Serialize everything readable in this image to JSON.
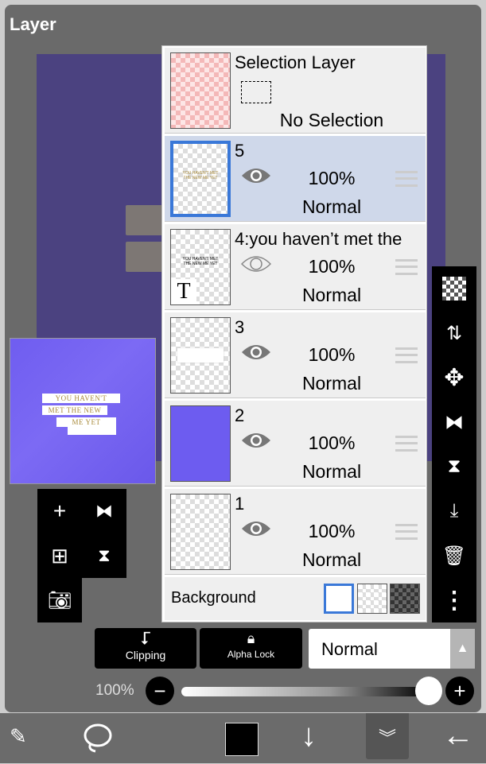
{
  "title": "Layer",
  "canvas_text": [
    "YOU HAVEN'T",
    "MET THE NEW",
    "ME YET"
  ],
  "selection_layer": {
    "name": "Selection Layer",
    "status": "No Selection"
  },
  "layers": [
    {
      "name": "5",
      "opacity": "100%",
      "mode": "Normal",
      "selected": true,
      "visible": true
    },
    {
      "name": "4:you haven’t met the",
      "opacity": "100%",
      "mode": "Normal",
      "selected": false,
      "visible": false,
      "type_icon": "T"
    },
    {
      "name": "3",
      "opacity": "100%",
      "mode": "Normal",
      "selected": false,
      "visible": true
    },
    {
      "name": "2",
      "opacity": "100%",
      "mode": "Normal",
      "selected": false,
      "visible": true
    },
    {
      "name": "1",
      "opacity": "100%",
      "mode": "Normal",
      "selected": false,
      "visible": true
    }
  ],
  "background": {
    "label": "Background"
  },
  "controls": {
    "clipping": "Clipping",
    "alpha_lock": "Alpha Lock",
    "blend_mode": "Normal",
    "opacity": "100%",
    "opacity_value": 100
  },
  "colors": {
    "accent": "#3a78d8",
    "canvas": "#4b4280",
    "layer2": "#6d5cf0",
    "primary_color": "#000000"
  }
}
